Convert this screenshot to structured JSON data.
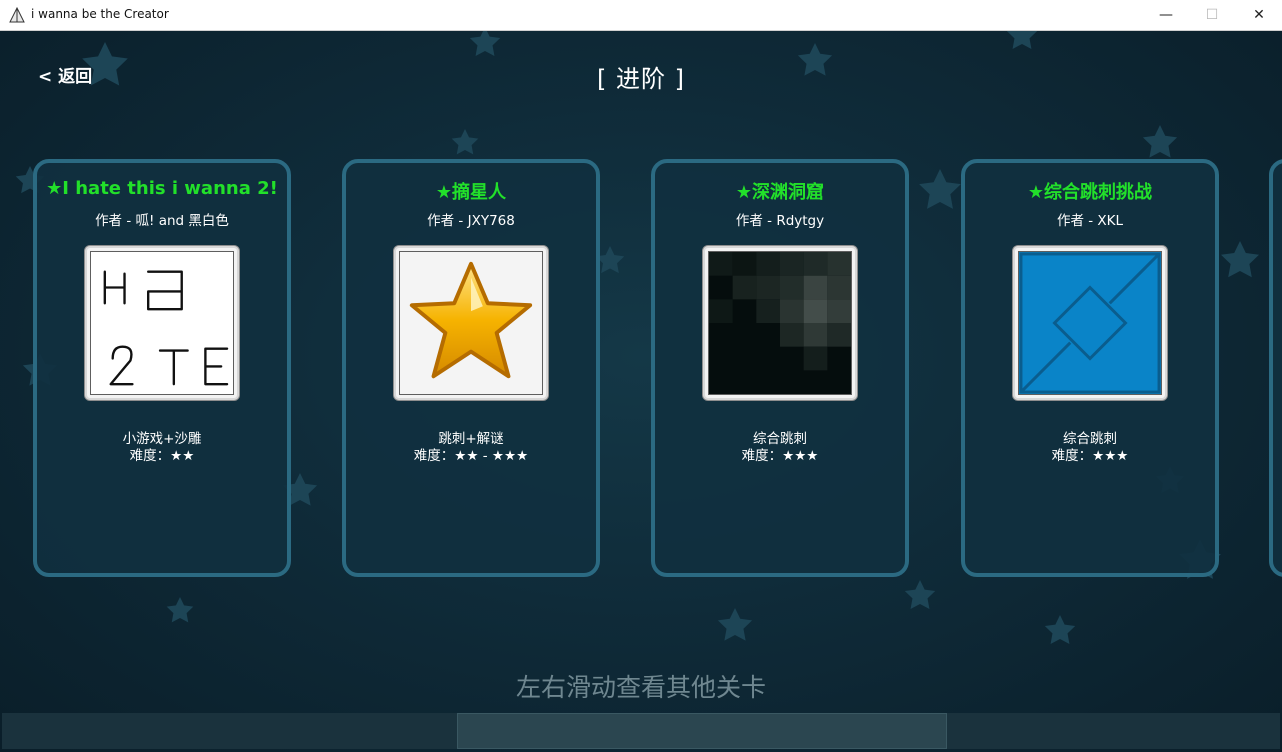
{
  "window": {
    "title": "i wanna be the Creator",
    "minimize": "—",
    "maximize": "☐",
    "close": "✕"
  },
  "nav": {
    "back_label": "< 返回",
    "page_title": "[ 进阶 ]"
  },
  "levels": [
    {
      "title": "★I hate this i wanna 2!",
      "author": "作者 - 呱! and 黑白色",
      "tags": "小游戏+沙雕",
      "difficulty": "难度：★★",
      "thumbnail_icon": "handwritten-text-thumbnail"
    },
    {
      "title": "★摘星人",
      "author": "作者 - JXY768",
      "tags": "跳刺+解谜",
      "difficulty": "难度：★★ - ★★★",
      "thumbnail_icon": "gold-star-thumbnail"
    },
    {
      "title": "★深渊洞窟",
      "author": "作者 - Rdytgy",
      "tags": "综合跳刺",
      "difficulty": "难度：★★★",
      "thumbnail_icon": "dark-pixel-cave-thumbnail"
    },
    {
      "title": "★综合跳刺挑战",
      "author": "作者 - XKL",
      "tags": "综合跳刺",
      "difficulty": "难度：★★★",
      "thumbnail_icon": "blue-diamond-thumbnail"
    }
  ],
  "hint": "左右滑动查看其他关卡",
  "colors": {
    "title_green": "#22e02a",
    "card_border": "#2b6a82",
    "background": "#0f2b39"
  }
}
